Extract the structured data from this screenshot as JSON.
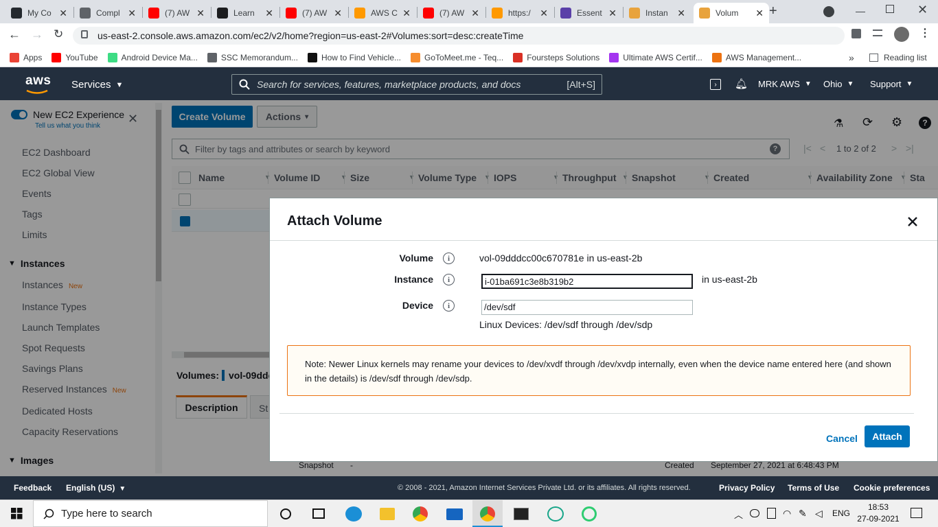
{
  "browser": {
    "tabs": [
      {
        "title": "My Co",
        "icon": "github-icon",
        "color": "#24292e"
      },
      {
        "title": "Compl",
        "icon": "globe-icon",
        "color": "#5f6368"
      },
      {
        "title": "(7) AW",
        "icon": "youtube-icon",
        "color": "#ff0000"
      },
      {
        "title": "Learn",
        "icon": "m-icon",
        "color": "#1c1d1f"
      },
      {
        "title": "(7) AW",
        "icon": "youtube-icon",
        "color": "#ff0000"
      },
      {
        "title": "AWS C",
        "icon": "aws-icon",
        "color": "#ff9900"
      },
      {
        "title": "(7) AW",
        "icon": "youtube-icon",
        "color": "#ff0000"
      },
      {
        "title": "https:/",
        "icon": "aws-icon",
        "color": "#ff9900"
      },
      {
        "title": "Essent",
        "icon": "doc-icon",
        "color": "#5a3fa8"
      },
      {
        "title": "Instan",
        "icon": "aws-cube-icon",
        "color": "#e8a33d"
      },
      {
        "title": "Volum",
        "icon": "aws-cube-icon",
        "color": "#e8a33d"
      }
    ],
    "url": "us-east-2.console.aws.amazon.com/ec2/v2/home?region=us-east-2#Volumes:sort=desc:createTime",
    "bookmarks": [
      {
        "label": "Apps",
        "color": "#ea4335"
      },
      {
        "label": "YouTube",
        "color": "#ff0000"
      },
      {
        "label": "Android Device Ma...",
        "color": "#3ddc84"
      },
      {
        "label": "SSC Memorandum...",
        "color": "#5f6368"
      },
      {
        "label": "How to Find Vehicle...",
        "color": "#111111"
      },
      {
        "label": "GoToMeet.me - Teq...",
        "color": "#f68d2e"
      },
      {
        "label": "Foursteps Solutions",
        "color": "#d93025"
      },
      {
        "label": "Ultimate AWS Certif...",
        "color": "#a435f0"
      },
      {
        "label": "AWS Management...",
        "color": "#ec7211"
      }
    ],
    "bookmarks_more": "»",
    "reading_list": "Reading list"
  },
  "aws_header": {
    "logo": "aws",
    "services": "Services",
    "search_placeholder": "Search for services, features, marketplace products, and docs",
    "search_shortcut": "[Alt+S]",
    "account": "MRK AWS",
    "region": "Ohio",
    "support": "Support"
  },
  "sidebar": {
    "experience_label": "New EC2 Experience",
    "experience_sub": "Tell us what you think",
    "items_top": [
      "EC2 Dashboard",
      "EC2 Global View",
      "Events",
      "Tags",
      "Limits"
    ],
    "section_instances": "Instances",
    "instances_items": [
      {
        "label": "Instances",
        "badge": "New"
      },
      {
        "label": "Instance Types",
        "badge": ""
      },
      {
        "label": "Launch Templates",
        "badge": ""
      },
      {
        "label": "Spot Requests",
        "badge": ""
      },
      {
        "label": "Savings Plans",
        "badge": ""
      },
      {
        "label": "Reserved Instances",
        "badge": "New"
      },
      {
        "label": "Dedicated Hosts",
        "badge": ""
      },
      {
        "label": "Capacity Reservations",
        "badge": ""
      }
    ],
    "section_images": "Images"
  },
  "toolbar": {
    "create_volume": "Create Volume",
    "actions": "Actions",
    "filter_placeholder": "Filter by tags and attributes or search by keyword",
    "pagination": "1 to 2 of 2"
  },
  "table": {
    "columns": [
      "Name",
      "Volume ID",
      "Size",
      "Volume Type",
      "IOPS",
      "Throughput",
      "Snapshot",
      "Created",
      "Availability Zone",
      "Sta"
    ]
  },
  "details": {
    "volumes_label": "Volumes:",
    "volume_short": "vol-09ddc",
    "tab_description": "Description",
    "tab_status": "St",
    "snapshot_label": "Snapshot",
    "snapshot_value": "-",
    "created_label": "Created",
    "created_value": "September 27, 2021 at 6:48:43 PM"
  },
  "modal": {
    "title": "Attach Volume",
    "volume_label": "Volume",
    "volume_value": "vol-09dddcc00c670781e in us-east-2b",
    "instance_label": "Instance",
    "instance_value": "i-01ba691c3e8b319b2",
    "instance_zone": "in us-east-2b",
    "device_label": "Device",
    "device_value": "/dev/sdf",
    "device_hint": "Linux Devices: /dev/sdf through /dev/sdp",
    "note": "Note: Newer Linux kernels may rename your devices to /dev/xvdf through /dev/xvdp internally, even when the device name entered here (and shown in the details) is /dev/sdf through /dev/sdp.",
    "cancel": "Cancel",
    "attach": "Attach"
  },
  "footer": {
    "feedback": "Feedback",
    "language": "English (US)",
    "copyright": "© 2008 - 2021, Amazon Internet Services Private Ltd. or its affiliates. All rights reserved.",
    "privacy": "Privacy Policy",
    "terms": "Terms of Use",
    "cookies": "Cookie preferences"
  },
  "taskbar": {
    "search_placeholder": "Type here to search",
    "lang": "ENG",
    "time": "18:53",
    "date": "27-09-2021"
  }
}
